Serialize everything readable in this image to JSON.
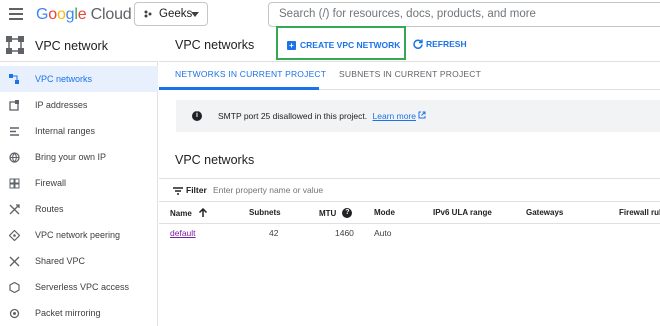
{
  "topbar": {
    "logo_google": [
      "G",
      "o",
      "o",
      "g",
      "l",
      "e"
    ],
    "logo_cloud": "Cloud",
    "project_name": "Geeks",
    "search_placeholder": "Search (/) for resources, docs, products, and more"
  },
  "sidebar": {
    "title": "VPC network",
    "items": [
      {
        "label": "VPC networks",
        "icon": "network-grid-icon",
        "active": true
      },
      {
        "label": "IP addresses",
        "icon": "ip-address-icon",
        "active": false
      },
      {
        "label": "Internal ranges",
        "icon": "internal-ranges-icon",
        "active": false
      },
      {
        "label": "Bring your own IP",
        "icon": "globe-icon",
        "active": false
      },
      {
        "label": "Firewall",
        "icon": "firewall-icon",
        "active": false
      },
      {
        "label": "Routes",
        "icon": "routes-icon",
        "active": false
      },
      {
        "label": "VPC network peering",
        "icon": "peering-icon",
        "active": false
      },
      {
        "label": "Shared VPC",
        "icon": "shared-vpc-icon",
        "active": false
      },
      {
        "label": "Serverless VPC access",
        "icon": "serverless-icon",
        "active": false
      },
      {
        "label": "Packet mirroring",
        "icon": "packet-mirroring-icon",
        "active": false
      }
    ]
  },
  "header": {
    "title": "VPC networks",
    "create_label": "CREATE VPC NETWORK",
    "refresh_label": "REFRESH"
  },
  "tabs": [
    {
      "label": "NETWORKS IN CURRENT PROJECT",
      "active": true
    },
    {
      "label": "SUBNETS IN CURRENT PROJECT",
      "active": false
    }
  ],
  "banner": {
    "message": "SMTP port 25 disallowed in this project.",
    "link": "Learn more"
  },
  "section_title": "VPC networks",
  "filter": {
    "label": "Filter",
    "placeholder": "Enter property name or value"
  },
  "table": {
    "columns": [
      "Name",
      "Subnets",
      "MTU",
      "Mode",
      "IPv6 ULA range",
      "Gateways",
      "Firewall rul"
    ],
    "rows": [
      {
        "name": "default",
        "subnets": "42",
        "mtu": "1460",
        "mode": "Auto",
        "ipv6": "",
        "gateways": "",
        "firewall": ""
      }
    ]
  },
  "colors": {
    "accent": "#1a73e8",
    "highlight": "#34a853",
    "active_bg": "#e8f0fe",
    "link_visited": "#7b1fa2"
  }
}
